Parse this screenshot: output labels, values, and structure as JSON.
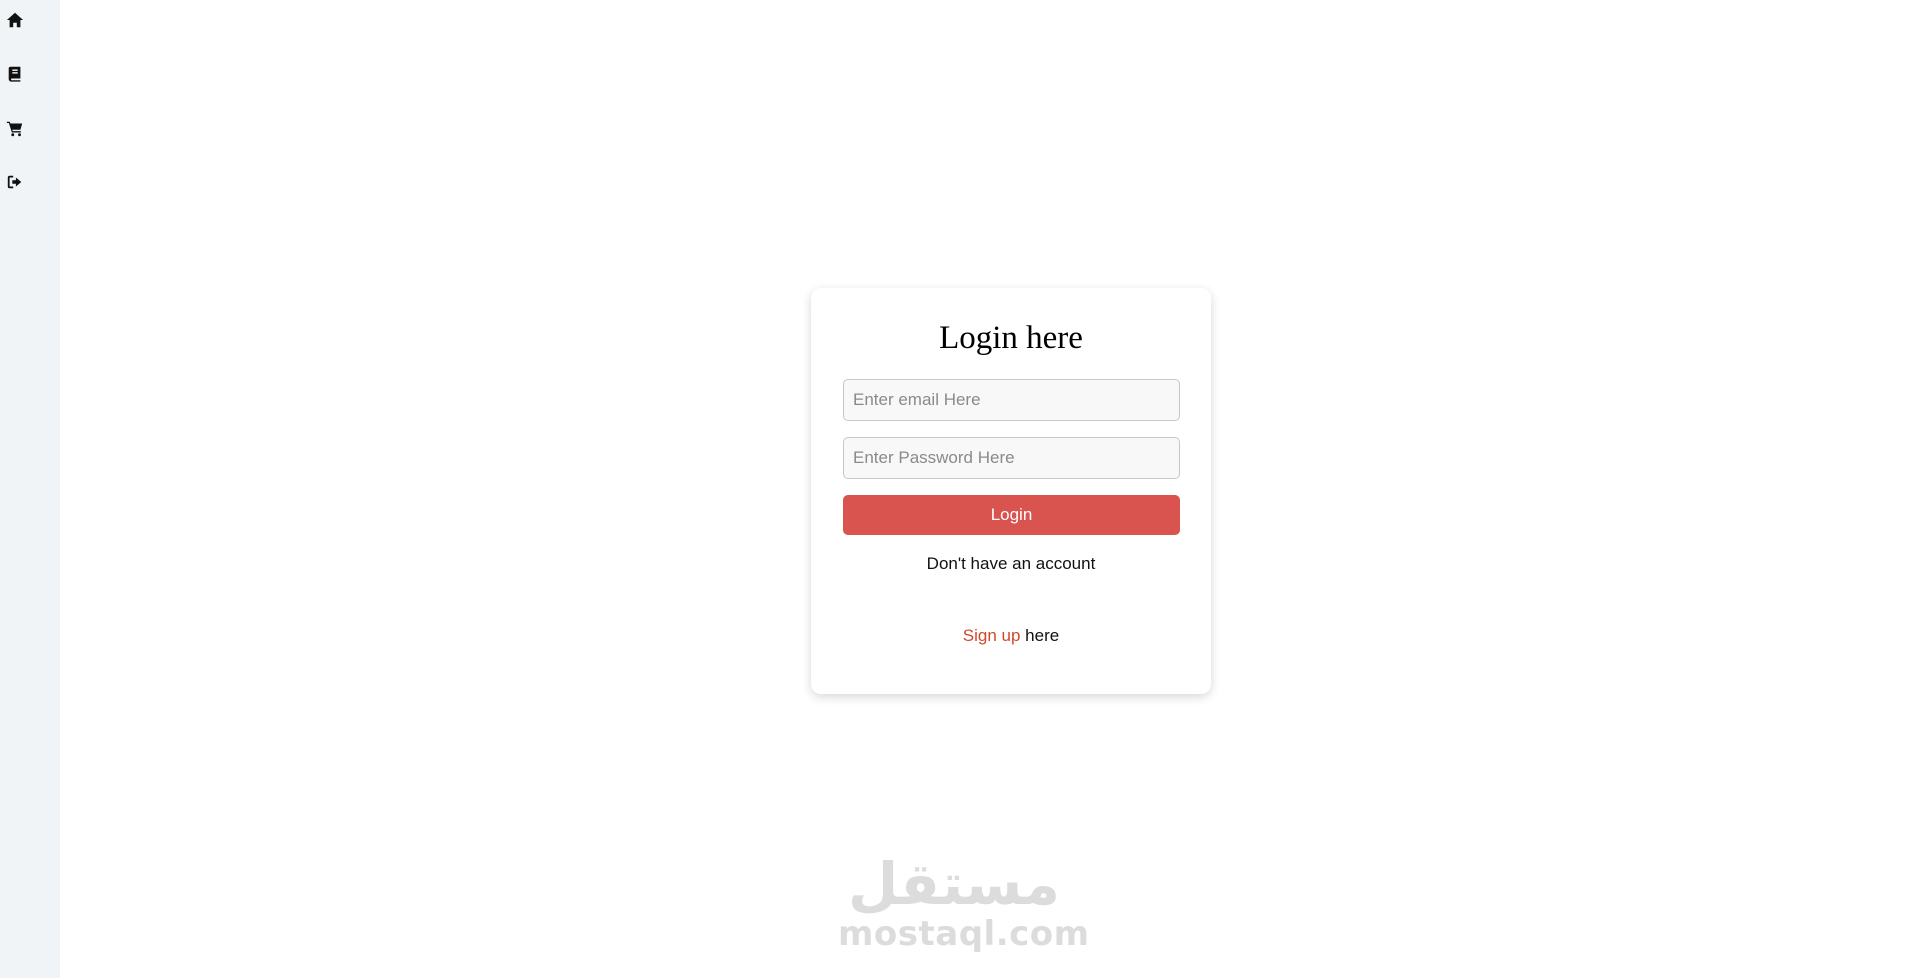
{
  "sidebar": {
    "items": [
      {
        "icon": "home-icon"
      },
      {
        "icon": "book-icon"
      },
      {
        "icon": "cart-icon"
      },
      {
        "icon": "logout-icon"
      }
    ]
  },
  "login": {
    "title": "Login here",
    "email_placeholder": "Enter email Here",
    "password_placeholder": "Enter Password Here",
    "button_label": "Login",
    "no_account_text": "Don't have an account",
    "signup_link_text": "Sign up",
    "signup_suffix": " here"
  },
  "watermark": {
    "arabic": "مستقل",
    "latin": "mostaql.com"
  },
  "colors": {
    "accent": "#d9534f",
    "link": "#cf4a2b",
    "sidebar_bg": "#f1f4f6"
  }
}
